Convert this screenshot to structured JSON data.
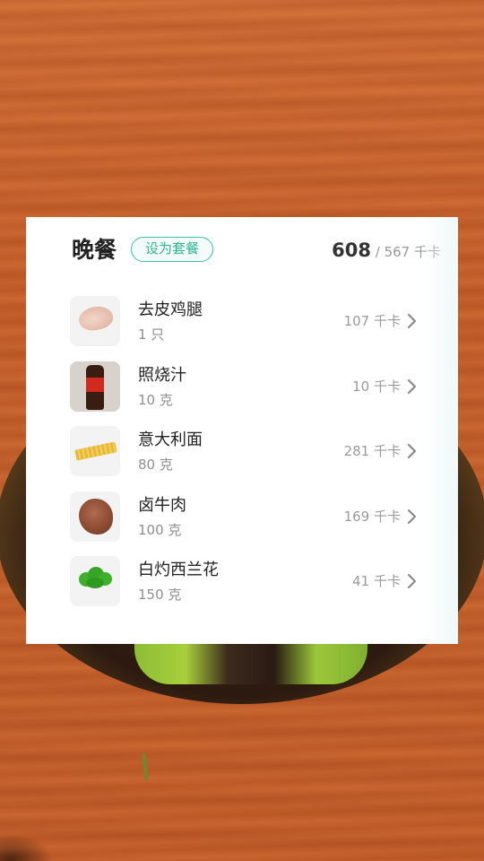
{
  "meal": {
    "title": "晚餐",
    "set_button_label": "设为套餐",
    "kcal_eaten": "608",
    "kcal_rest": " / 567 千卡"
  },
  "items": [
    {
      "name": "去皮鸡腿",
      "amount": "1 只",
      "kcal": "107 千卡",
      "icon": "chicken-leg-icon"
    },
    {
      "name": "照烧汁",
      "amount": "10 克",
      "kcal": "10 千卡",
      "icon": "sauce-bottle-icon"
    },
    {
      "name": "意大利面",
      "amount": "80 克",
      "kcal": "281 千卡",
      "icon": "pasta-icon"
    },
    {
      "name": "卤牛肉",
      "amount": "100 克",
      "kcal": "169 千卡",
      "icon": "beef-icon"
    },
    {
      "name": "白灼西兰花",
      "amount": "150 克",
      "kcal": "41 千卡",
      "icon": "broccoli-icon"
    }
  ],
  "colors": {
    "accent": "#3cc2a0",
    "text_primary": "#222222",
    "text_secondary": "#9a9a9a"
  }
}
